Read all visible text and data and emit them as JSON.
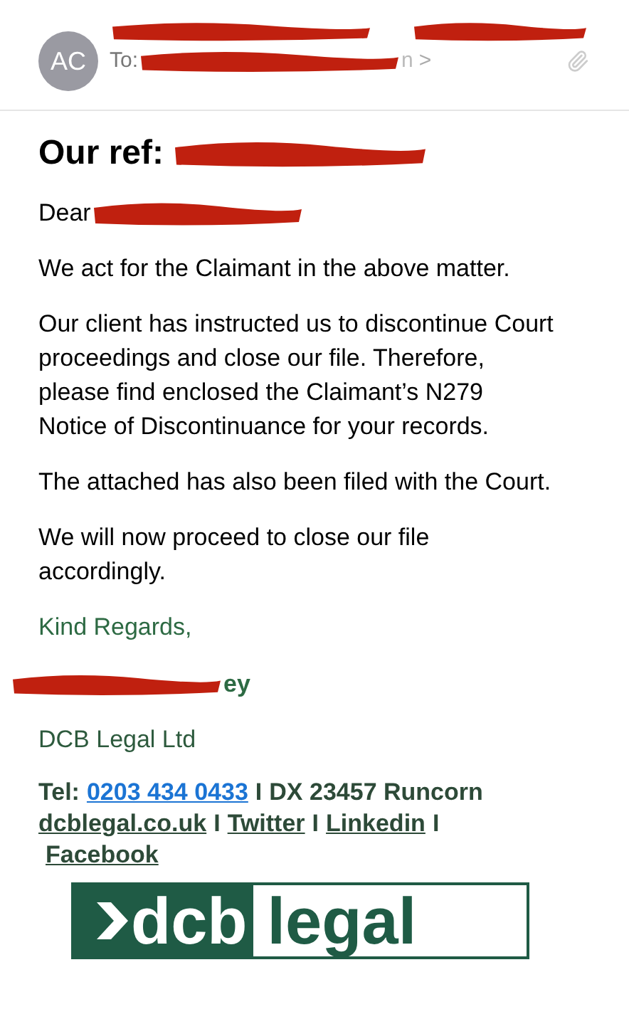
{
  "header": {
    "avatar": "AC",
    "to_label": "To:",
    "to_tail": "n",
    "chevron": ">"
  },
  "subject": {
    "label": "Our ref:"
  },
  "greeting": "Dear",
  "paragraphs": [
    "We act for the Claimant in the above matter.",
    "Our client has instructed us to discontinue Court proceedings and close our file. Therefore, please find enclosed the Claimant’s N279 Notice of Discontinuance for your records.",
    "The attached has also been filed with the Court.",
    "We will now proceed to close our file accordingly."
  ],
  "closing": "Kind Regards,",
  "signature_tail": "ey",
  "company": "DCB Legal Ltd",
  "contact": {
    "tel_label": "Tel:",
    "phone": "0203 434 0433",
    "separator": "I",
    "dx": "DX 23457 Runcorn",
    "links": [
      {
        "text": "dcblegal.co.uk",
        "separator": "I"
      },
      {
        "text": "Twitter",
        "separator": "I"
      },
      {
        "text": "Linkedin",
        "separator": "I"
      },
      {
        "text": "Facebook"
      }
    ]
  },
  "logo": {
    "dark": "dcb",
    "light": "legal"
  }
}
